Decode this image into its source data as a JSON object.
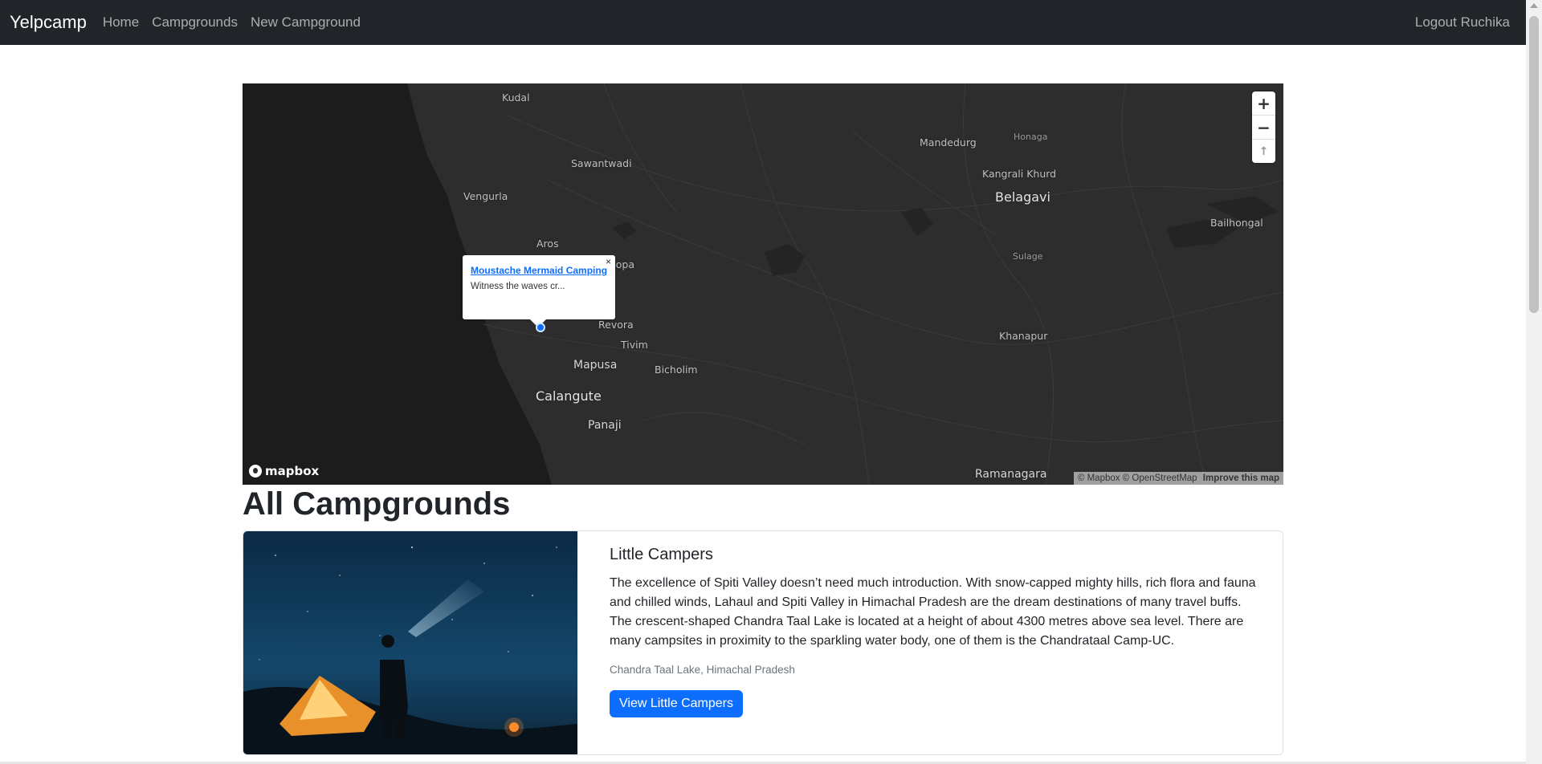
{
  "nav": {
    "brand": "Yelpcamp",
    "links": [
      "Home",
      "Campgrounds",
      "New Campground"
    ],
    "logout": "Logout Ruchika"
  },
  "map": {
    "places": [
      {
        "name": "Kudal"
      },
      {
        "name": "Sawantwadi"
      },
      {
        "name": "Vengurla"
      },
      {
        "name": "Aros"
      },
      {
        "name": "Mopa"
      },
      {
        "name": "Revora"
      },
      {
        "name": "Tivim"
      },
      {
        "name": "Mapusa"
      },
      {
        "name": "Bicholim"
      },
      {
        "name": "Calangute"
      },
      {
        "name": "Panaji"
      },
      {
        "name": "Mandedurg"
      },
      {
        "name": "Honaga"
      },
      {
        "name": "Kangrali Khurd"
      },
      {
        "name": "Belagavi"
      },
      {
        "name": "Bailhongal"
      },
      {
        "name": "Sulage"
      },
      {
        "name": "Khanapur"
      },
      {
        "name": "Ramanagara"
      }
    ],
    "popup": {
      "title": "Moustache Mermaid Camping",
      "text": "Witness the waves cr...",
      "close": "×"
    },
    "zoom_in": "+",
    "zoom_out": "−",
    "compass": "↑",
    "logo": "mapbox",
    "attribution": "© Mapbox © OpenStreetMap",
    "improve": "Improve this map"
  },
  "page_title": "All Campgrounds",
  "campground": {
    "title": "Little Campers",
    "description": "The excellence of Spiti Valley doesn’t need much introduction. With snow-capped mighty hills, rich flora and fauna and chilled winds, Lahaul and Spiti Valley in Himachal Pradesh are the dream destinations of many travel buffs. The crescent-shaped Chandra Taal Lake is located at a height of about 4300 metres above sea level. There are many campsites in proximity to the sparkling water body, one of them is the Chandrataal Camp-UC.",
    "location": "Chandra Taal Lake, Himachal Pradesh",
    "button": "View Little Campers"
  },
  "colors": {
    "navbar": "#212529",
    "primary": "#0d6efd",
    "map_land": "#2d2d2d",
    "map_sea": "#1f1f1f"
  }
}
